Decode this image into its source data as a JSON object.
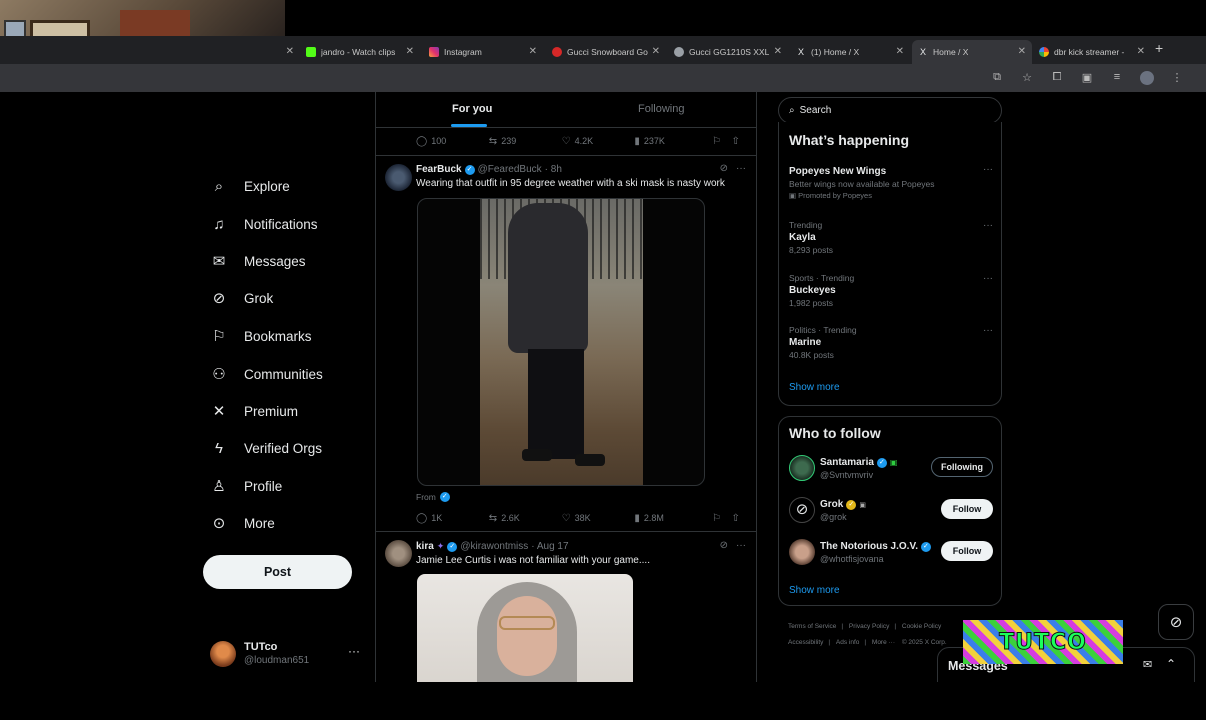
{
  "browser": {
    "tabs": [
      {
        "label": "",
        "icon": "tab-icon",
        "color": "#5f6368"
      },
      {
        "label": "jandro - Watch clips",
        "icon": "kick-icon",
        "color": "#53fc18"
      },
      {
        "label": "Instagram",
        "icon": "instagram-icon",
        "color": "#e1306c"
      },
      {
        "label": "Gucci Snowboard Go",
        "icon": "gucci-icon",
        "color": "#d62828"
      },
      {
        "label": "Gucci GG1210S XXL",
        "icon": "site-icon",
        "color": "#9aa0a6"
      },
      {
        "label": "(1) Home / X",
        "icon": "x-icon",
        "color": "#e7e9ea"
      },
      {
        "label": "Home / X",
        "icon": "x-icon",
        "color": "#e7e9ea"
      },
      {
        "label": "dbr kick streamer - ",
        "icon": "google-icon",
        "color": "#4285f4"
      }
    ],
    "new_tab": "+"
  },
  "nav": {
    "items": [
      {
        "label": "Explore",
        "icon": "search-icon",
        "glyph": "⌕"
      },
      {
        "label": "Notifications",
        "icon": "bell-icon",
        "glyph": "🔔︎"
      },
      {
        "label": "Messages",
        "icon": "mail-icon",
        "glyph": "✉"
      },
      {
        "label": "Grok",
        "icon": "grok-icon",
        "glyph": "⊘"
      },
      {
        "label": "Bookmarks",
        "icon": "bookmark-icon",
        "glyph": "🔖︎"
      },
      {
        "label": "Communities",
        "icon": "communities-icon",
        "glyph": "👥︎"
      },
      {
        "label": "Premium",
        "icon": "x-logo-icon",
        "glyph": "𝕏"
      },
      {
        "label": "Verified Orgs",
        "icon": "lightning-icon",
        "glyph": "ϟ"
      },
      {
        "label": "Profile",
        "icon": "person-icon",
        "glyph": "👤︎"
      },
      {
        "label": "More",
        "icon": "more-circle-icon",
        "glyph": "⊙"
      }
    ],
    "post_label": "Post"
  },
  "account": {
    "name": "TUTco",
    "handle": "@loudman651",
    "more": "···"
  },
  "feed": {
    "tabs": {
      "for_you": "For you",
      "following": "Following"
    },
    "top_actions": {
      "replies": "100",
      "reposts": "239",
      "likes": "4.2K",
      "views": "237K"
    },
    "tweet1": {
      "name": "FearBuck",
      "handle": "@FearedBuck",
      "time": "· 8h",
      "text": "Wearing that outfit in 95 degree weather with a ski mask is nasty work",
      "from_label": "From",
      "actions": {
        "replies": "1K",
        "reposts": "2.6K",
        "likes": "38K",
        "views": "2.8M"
      }
    },
    "tweet2": {
      "name": "kira",
      "handle": "@kirawontmiss",
      "time": "· Aug 17",
      "text": "Jamie Lee Curtis i was not familiar with your game...."
    }
  },
  "right": {
    "search_placeholder": "Search",
    "happening": {
      "title": "What’s happening",
      "trends": [
        {
          "meta": "",
          "title": "Popeyes New Wings",
          "sub": "Better wings now available at Popeyes",
          "sub2": "Promoted by Popeyes"
        },
        {
          "meta": "Trending",
          "title": "Kayla",
          "sub": "8,293 posts",
          "sub2": ""
        },
        {
          "meta": "Sports · Trending",
          "title": "Buckeyes",
          "sub": "1,982 posts",
          "sub2": ""
        },
        {
          "meta": "Politics · Trending",
          "title": "Marine",
          "sub": "40.8K posts",
          "sub2": ""
        }
      ],
      "show_more": "Show more"
    },
    "who_to_follow": {
      "title": "Who to follow",
      "users": [
        {
          "name": "Santamaria",
          "handle": "@Svntvmvriv",
          "button": "Following",
          "avatar_color": "#2f4f3a"
        },
        {
          "name": "Grok",
          "handle": "@grok",
          "button": "Follow",
          "avatar_color": "#111111"
        },
        {
          "name": "The Notorious J.O.V.",
          "handle": "@whotfisjovana",
          "button": "Follow",
          "avatar_color": "#8a6a58"
        }
      ],
      "show_more": "Show more"
    },
    "footer": [
      "Terms of Service",
      "Privacy Policy",
      "Cookie Policy",
      "Accessibility",
      "Ads info",
      "More ···",
      "© 2025 X Corp."
    ]
  },
  "messages_bar": {
    "label": "Messages"
  },
  "overlay": {
    "logo_text": "TUTCO"
  },
  "colors": {
    "accent": "#1d9bf0",
    "background": "#000000",
    "border": "#2f3336",
    "muted": "#71767b"
  }
}
